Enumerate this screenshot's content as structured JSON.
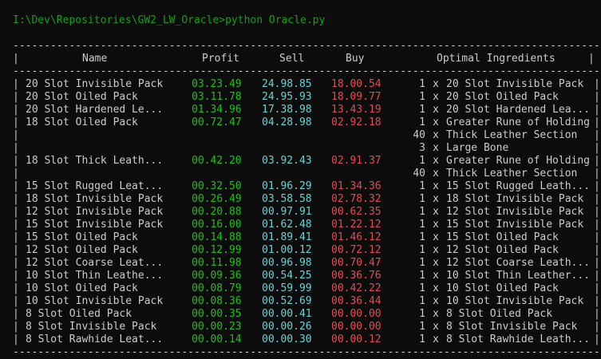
{
  "prompt": {
    "path": "I:\\Dev\\Repositories\\GW2_LW_Oracle>",
    "command": "python Oracle.py"
  },
  "separator": "-----------------------------------------------------------------------------------------------",
  "headers": {
    "name": "Name",
    "profit": "Profit",
    "sell": "Sell",
    "buy": "Buy",
    "ingredients": "Optimal Ingredients"
  },
  "rows": [
    {
      "name": "20 Slot Invisible Pack",
      "profit": "03.23.49",
      "sell": "24.98.85",
      "buy": "18.00.54",
      "ingredients": [
        {
          "qty": "1",
          "item": "20 Slot Invisible Pack"
        }
      ]
    },
    {
      "name": "20 Slot Oiled Pack",
      "profit": "03.11.78",
      "sell": "24.95.93",
      "buy": "18.09.77",
      "ingredients": [
        {
          "qty": "1",
          "item": "20 Slot Oiled Pack"
        }
      ]
    },
    {
      "name": "20 Slot Hardened Le...",
      "profit": "01.34.96",
      "sell": "17.38.98",
      "buy": "13.43.19",
      "ingredients": [
        {
          "qty": "1",
          "item": "20 Slot Hardened Lea..."
        }
      ]
    },
    {
      "name": "18 Slot Oiled Pack",
      "profit": "00.72.47",
      "sell": "04.28.98",
      "buy": "02.92.18",
      "ingredients": [
        {
          "qty": "1",
          "item": "Greater Rune of Holding"
        },
        {
          "qty": "40",
          "item": "Thick Leather Section"
        },
        {
          "qty": "3",
          "item": "Large Bone"
        }
      ]
    },
    {
      "name": "18 Slot Thick Leath...",
      "profit": "00.42.20",
      "sell": "03.92.43",
      "buy": "02.91.37",
      "ingredients": [
        {
          "qty": "1",
          "item": "Greater Rune of Holding"
        },
        {
          "qty": "40",
          "item": "Thick Leather Section"
        }
      ]
    },
    {
      "name": "15 Slot Rugged Leat...",
      "profit": "00.32.50",
      "sell": "01.96.29",
      "buy": "01.34.36",
      "ingredients": [
        {
          "qty": "1",
          "item": "15 Slot Rugged Leath..."
        }
      ]
    },
    {
      "name": "18 Slot Invisible Pack",
      "profit": "00.26.49",
      "sell": "03.58.58",
      "buy": "02.78.32",
      "ingredients": [
        {
          "qty": "1",
          "item": "18 Slot Invisible Pack"
        }
      ]
    },
    {
      "name": "12 Slot Invisible Pack",
      "profit": "00.20.88",
      "sell": "00.97.91",
      "buy": "00.62.35",
      "ingredients": [
        {
          "qty": "1",
          "item": "12 Slot Invisible Pack"
        }
      ]
    },
    {
      "name": "15 Slot Invisible Pack",
      "profit": "00.16.00",
      "sell": "01.62.48",
      "buy": "01.22.12",
      "ingredients": [
        {
          "qty": "1",
          "item": "15 Slot Invisible Pack"
        }
      ]
    },
    {
      "name": "15 Slot Oiled Pack",
      "profit": "00.14.88",
      "sell": "01.89.41",
      "buy": "01.46.12",
      "ingredients": [
        {
          "qty": "1",
          "item": "15 Slot Oiled Pack"
        }
      ]
    },
    {
      "name": "12 Slot Oiled Pack",
      "profit": "00.12.99",
      "sell": "01.00.12",
      "buy": "00.72.12",
      "ingredients": [
        {
          "qty": "1",
          "item": "12 Slot Oiled Pack"
        }
      ]
    },
    {
      "name": "12 Slot Coarse Leat...",
      "profit": "00.11.98",
      "sell": "00.96.98",
      "buy": "00.70.47",
      "ingredients": [
        {
          "qty": "1",
          "item": "12 Slot Coarse Leath..."
        }
      ]
    },
    {
      "name": "10 Slot Thin Leathe...",
      "profit": "00.09.36",
      "sell": "00.54.25",
      "buy": "00.36.76",
      "ingredients": [
        {
          "qty": "1",
          "item": "10 Slot Thin Leather..."
        }
      ]
    },
    {
      "name": "10 Slot Oiled Pack",
      "profit": "00.08.79",
      "sell": "00.59.99",
      "buy": "00.42.22",
      "ingredients": [
        {
          "qty": "1",
          "item": "10 Slot Oiled Pack"
        }
      ]
    },
    {
      "name": "10 Slot Invisible Pack",
      "profit": "00.08.36",
      "sell": "00.52.69",
      "buy": "00.36.44",
      "ingredients": [
        {
          "qty": "1",
          "item": "10 Slot Invisible Pack"
        }
      ]
    },
    {
      "name": "8 Slot Oiled Pack",
      "profit": "00.00.35",
      "sell": "00.00.41",
      "buy": "00.00.00",
      "ingredients": [
        {
          "qty": "1",
          "item": "8 Slot Oiled Pack"
        }
      ]
    },
    {
      "name": "8 Slot Invisible Pack",
      "profit": "00.00.23",
      "sell": "00.00.26",
      "buy": "00.00.00",
      "ingredients": [
        {
          "qty": "1",
          "item": "8 Slot Invisible Pack"
        }
      ]
    },
    {
      "name": "8 Slot Rawhide Leat...",
      "profit": "00.00.14",
      "sell": "00.00.30",
      "buy": "00.00.12",
      "ingredients": [
        {
          "qty": "1",
          "item": "8 Slot Rawhide Leath..."
        }
      ]
    }
  ],
  "colors": {
    "profit": "#16c60c",
    "sell": "#61d6d6",
    "buy": "#e74856",
    "prompt": "#13a10e"
  }
}
